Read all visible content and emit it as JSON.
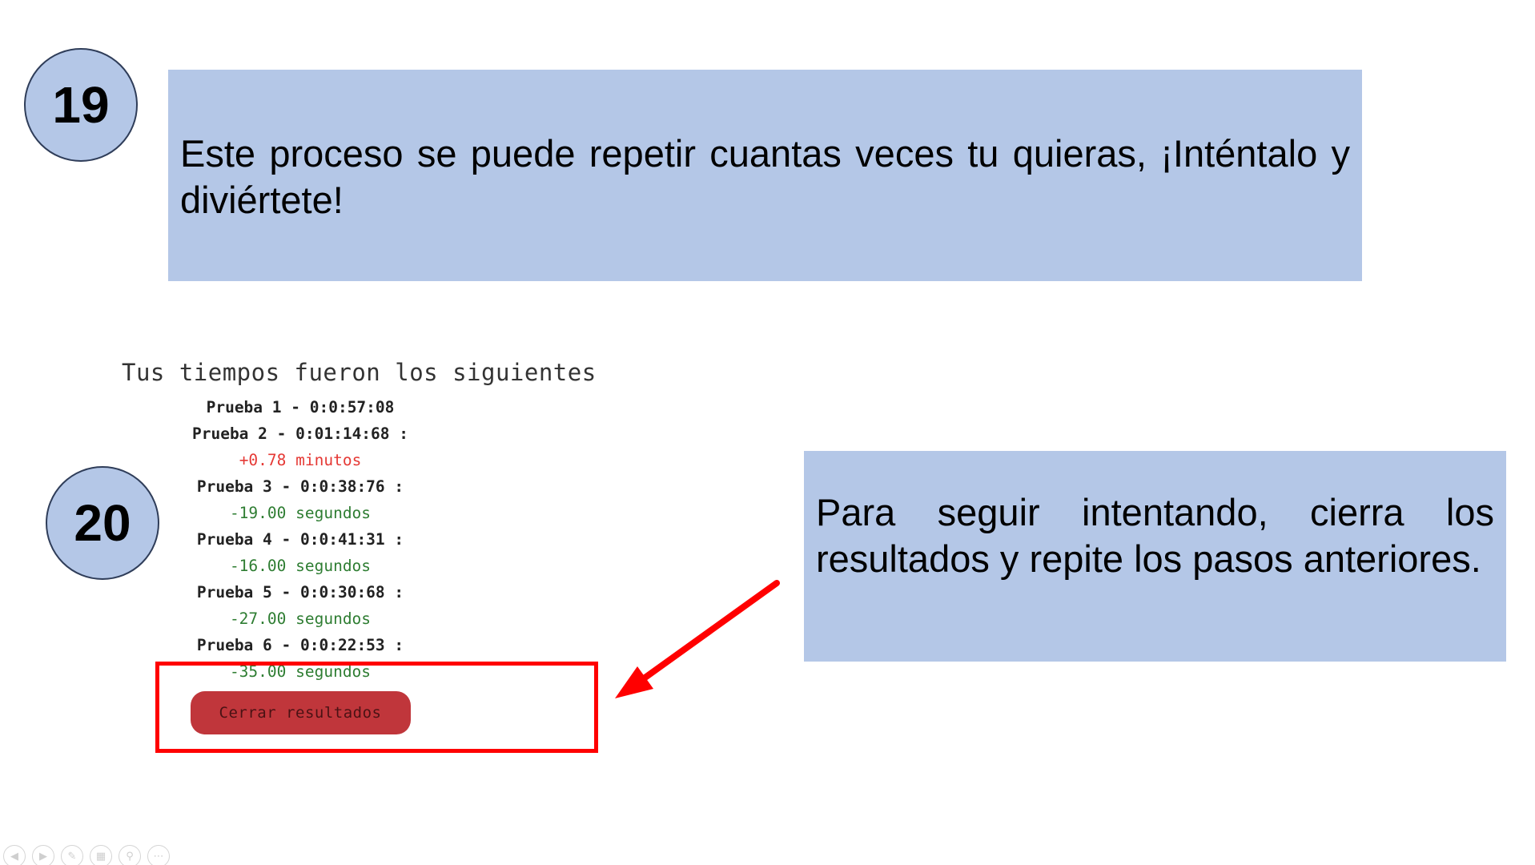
{
  "steps": {
    "step19": {
      "number": "19",
      "text": "Este proceso se puede repetir cuantas veces tu quieras, ¡Inténtalo y  diviértete!"
    },
    "step20": {
      "number": "20",
      "text": "Para seguir intentando, cierra los resultados y repite los pasos anteriores."
    }
  },
  "results": {
    "title": "Tus tiempos fueron los siguientes",
    "trials": [
      {
        "line": "Prueba 1 - 0:0:57:08",
        "diff": ""
      },
      {
        "line": "Prueba 2 - 0:01:14:68 :",
        "diff": "+0.78 minutos"
      },
      {
        "line": "Prueba 3 - 0:0:38:76 :",
        "diff": "-19.00 segundos"
      },
      {
        "line": "Prueba 4 - 0:0:41:31 :",
        "diff": "-16.00 segundos"
      },
      {
        "line": "Prueba 5 - 0:0:30:68 :",
        "diff": "-27.00 segundos"
      },
      {
        "line": "Prueba 6 - 0:0:22:53 :",
        "diff": "-35.00 segundos"
      }
    ],
    "close_button": "Cerrar resultados"
  },
  "colors": {
    "box_fill": "#b4c7e7",
    "highlight": "#ff0000",
    "increase": "#e53935",
    "decrease": "#2e7d32",
    "button": "#c0363b"
  },
  "toolbar": {
    "icons": [
      "prev-icon",
      "next-icon",
      "pen-icon",
      "slides-icon",
      "zoom-icon",
      "more-icon"
    ]
  }
}
